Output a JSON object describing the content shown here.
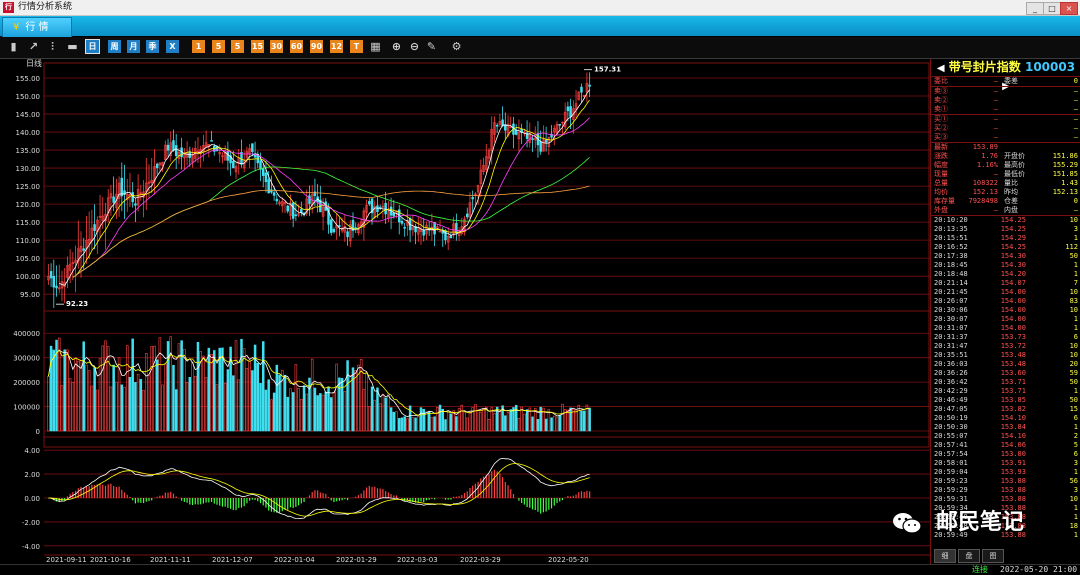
{
  "window": {
    "title": "行情分析系统",
    "app_icon": "行"
  },
  "tabs": [
    {
      "label": "行 情",
      "icon": "app-logo-icon"
    }
  ],
  "toolbar": {
    "icons": [
      {
        "name": "bar-chart-icon",
        "g": "▮",
        "style": "plain"
      },
      {
        "name": "line-chart-icon",
        "g": "↗",
        "style": "plain"
      },
      {
        "name": "kline-icon",
        "g": "⫶",
        "style": "plain"
      },
      {
        "name": "volume-icon",
        "g": "▬",
        "style": "plain"
      },
      {
        "name": "day-period-button",
        "g": "日",
        "style": "blue"
      },
      {
        "name": "week-period-button",
        "g": "周",
        "style": "blue"
      },
      {
        "name": "month-period-button",
        "g": "月",
        "style": "blue"
      },
      {
        "name": "quarter-period-button",
        "g": "季",
        "style": "blue"
      },
      {
        "name": "year-period-button",
        "g": "X",
        "style": "blue"
      },
      {
        "name": "minute1-button",
        "g": "1",
        "style": "orange"
      },
      {
        "name": "minute5-button",
        "g": "5",
        "style": "orange"
      },
      {
        "name": "minute10-button",
        "g": "5",
        "style": "orange"
      },
      {
        "name": "minute15-button",
        "g": "15",
        "style": "orange"
      },
      {
        "name": "minute30-button",
        "g": "30",
        "style": "orange"
      },
      {
        "name": "minute60-button",
        "g": "60",
        "style": "orange"
      },
      {
        "name": "minute90-button",
        "g": "90",
        "style": "orange"
      },
      {
        "name": "minute120-button",
        "g": "12",
        "style": "orange"
      },
      {
        "name": "tick-button",
        "g": "T",
        "style": "orange"
      },
      {
        "name": "calendar-icon",
        "g": "▦",
        "style": "plain"
      },
      {
        "name": "zoom-in-icon",
        "g": "⊕",
        "style": "plain"
      },
      {
        "name": "zoom-out-icon",
        "g": "⊖",
        "style": "plain"
      },
      {
        "name": "draw-tool-icon",
        "g": "✎",
        "style": "plain"
      },
      {
        "name": "settings-icon",
        "g": "⚙",
        "style": "plain"
      }
    ]
  },
  "chart": {
    "period_label": "日线",
    "max_label": "157.31",
    "min_label": "92.23",
    "price_ticks": [
      "155.00",
      "150.00",
      "145.00",
      "140.00",
      "135.00",
      "130.00",
      "125.00",
      "120.00",
      "115.00",
      "110.00",
      "105.00",
      "100.00",
      "95.00"
    ],
    "volume_ticks": [
      "400000",
      "300000",
      "200000",
      "100000",
      "0"
    ],
    "macd_ticks": [
      "4.00",
      "2.00",
      "0.00",
      "-2.00",
      "-4.00"
    ],
    "date_labels": [
      "2021-09-11",
      "2021-10-16",
      "2021-11-11",
      "2021-12-07",
      "2022-01-04",
      "2022-01-29",
      "2022-03-03",
      "2022-03-29",
      "2022-05-20"
    ],
    "colors": {
      "up": "#ff4040",
      "down": "#40e0f0",
      "grid": "#7a1010",
      "ma5": "#ffffff",
      "ma10": "#ffff00",
      "ma20": "#ff40ff",
      "ma60": "#40ff40",
      "ma120": "#ffa040"
    }
  },
  "chart_data": {
    "type": "candlestick",
    "price_range": [
      92.23,
      157.31
    ],
    "price_axis": [
      95,
      155
    ],
    "volume_axis": [
      0,
      400000
    ],
    "macd_axis": [
      -4,
      4
    ],
    "anchors": [
      {
        "i": 0,
        "p": 100
      },
      {
        "i": 4,
        "p": 97
      },
      {
        "i": 8,
        "p": 103
      },
      {
        "i": 14,
        "p": 110
      },
      {
        "i": 20,
        "p": 118
      },
      {
        "i": 26,
        "p": 124
      },
      {
        "i": 32,
        "p": 121
      },
      {
        "i": 38,
        "p": 128
      },
      {
        "i": 44,
        "p": 136
      },
      {
        "i": 50,
        "p": 133
      },
      {
        "i": 56,
        "p": 137
      },
      {
        "i": 62,
        "p": 135
      },
      {
        "i": 68,
        "p": 131
      },
      {
        "i": 74,
        "p": 134
      },
      {
        "i": 80,
        "p": 126
      },
      {
        "i": 86,
        "p": 120
      },
      {
        "i": 92,
        "p": 117
      },
      {
        "i": 98,
        "p": 122
      },
      {
        "i": 104,
        "p": 114
      },
      {
        "i": 110,
        "p": 112
      },
      {
        "i": 116,
        "p": 118
      },
      {
        "i": 122,
        "p": 120
      },
      {
        "i": 128,
        "p": 117
      },
      {
        "i": 134,
        "p": 114
      },
      {
        "i": 140,
        "p": 113
      },
      {
        "i": 146,
        "p": 111
      },
      {
        "i": 152,
        "p": 115
      },
      {
        "i": 158,
        "p": 125
      },
      {
        "i": 164,
        "p": 142
      },
      {
        "i": 170,
        "p": 140
      },
      {
        "i": 176,
        "p": 138
      },
      {
        "i": 182,
        "p": 136
      },
      {
        "i": 188,
        "p": 142
      },
      {
        "i": 194,
        "p": 148
      },
      {
        "i": 199,
        "p": 154
      }
    ],
    "bars": 200,
    "volume_levels": [
      {
        "from": 0,
        "to": 80,
        "v": 300000
      },
      {
        "from": 80,
        "to": 118,
        "v": 230000
      },
      {
        "from": 118,
        "to": 126,
        "v": 140000
      },
      {
        "from": 126,
        "to": 200,
        "v": 85000
      }
    ]
  },
  "quote": {
    "name": "带号封片指数",
    "code": "100003",
    "order_rows": [
      {
        "l": "委比",
        "v": "—",
        "l2": "委差",
        "v2": "0"
      },
      {
        "l": "卖③",
        "v": "—",
        "l2": "",
        "v2": "—"
      },
      {
        "l": "卖②",
        "v": "—",
        "l2": "",
        "v2": "—"
      },
      {
        "l": "卖①",
        "v": "—",
        "l2": "",
        "v2": "—"
      },
      {
        "l": "买①",
        "v": "—",
        "l2": "",
        "v2": "—"
      },
      {
        "l": "买②",
        "v": "—",
        "l2": "",
        "v2": "—"
      },
      {
        "l": "买③",
        "v": "—",
        "l2": "",
        "v2": "—"
      }
    ],
    "stat_rows": [
      {
        "l": "最新",
        "v": "153.89",
        "l2": "",
        "v2": ""
      },
      {
        "l": "涨跌",
        "v": "1.76",
        "l2": "开盘价",
        "v2": "151.86"
      },
      {
        "l": "幅度",
        "v": "1.16%",
        "l2": "最高价",
        "v2": "155.29"
      },
      {
        "l": "现量",
        "v": "—",
        "l2": "最低价",
        "v2": "151.85"
      },
      {
        "l": "总量",
        "v": "108322",
        "l2": "量比",
        "v2": "1.43"
      },
      {
        "l": "均价",
        "v": "152.13",
        "l2": "昨均",
        "v2": "152.13"
      },
      {
        "l": "库存量",
        "v": "7928498",
        "l2": "仓差",
        "v2": "0"
      },
      {
        "l": "外盘",
        "v": "—",
        "l2": "内盘",
        "v2": "—"
      }
    ],
    "trades": [
      [
        "20:10:20",
        "154.25",
        "10"
      ],
      [
        "20:13:35",
        "154.25",
        "3"
      ],
      [
        "20:15:51",
        "154.29",
        "1"
      ],
      [
        "20:16:52",
        "154.25",
        "112"
      ],
      [
        "20:17:38",
        "154.30",
        "50"
      ],
      [
        "20:18:45",
        "154.30",
        "1"
      ],
      [
        "20:18:48",
        "154.20",
        "1"
      ],
      [
        "20:21:14",
        "154.07",
        "7"
      ],
      [
        "20:21:45",
        "154.00",
        "10"
      ],
      [
        "20:26:07",
        "154.00",
        "83"
      ],
      [
        "20:30:06",
        "154.00",
        "10"
      ],
      [
        "20:30:07",
        "154.00",
        "1"
      ],
      [
        "20:31:07",
        "154.00",
        "1"
      ],
      [
        "20:31:37",
        "153.73",
        "6"
      ],
      [
        "20:31:47",
        "153.72",
        "10"
      ],
      [
        "20:35:51",
        "153.48",
        "10"
      ],
      [
        "20:36:03",
        "153.48",
        "20"
      ],
      [
        "20:36:26",
        "153.60",
        "59"
      ],
      [
        "20:36:42",
        "153.71",
        "50"
      ],
      [
        "20:42:29",
        "153.71",
        "1"
      ],
      [
        "20:46:49",
        "153.85",
        "50"
      ],
      [
        "20:47:05",
        "153.82",
        "15"
      ],
      [
        "20:50:19",
        "154.10",
        "6"
      ],
      [
        "20:50:30",
        "153.84",
        "1"
      ],
      [
        "20:55:07",
        "154.10",
        "2"
      ],
      [
        "20:57:41",
        "154.06",
        "5"
      ],
      [
        "20:57:54",
        "153.80",
        "6"
      ],
      [
        "20:58:01",
        "153.91",
        "3"
      ],
      [
        "20:59:04",
        "153.93",
        "1"
      ],
      [
        "20:59:23",
        "153.88",
        "56"
      ],
      [
        "20:59:29",
        "153.88",
        "3"
      ],
      [
        "20:59:31",
        "153.88",
        "10"
      ],
      [
        "20:59:34",
        "153.88",
        "1"
      ],
      [
        "20:59:40",
        "153.88",
        "1"
      ],
      [
        "20:59:48",
        "153.88",
        "18"
      ],
      [
        "20:59:49",
        "153.88",
        "1"
      ]
    ],
    "tabs": [
      "细",
      "盘",
      "图"
    ]
  },
  "status": {
    "connection": "连接",
    "datetime": "2022-05-20 21:00"
  },
  "watermark": {
    "text": "邮民笔记",
    "icon": "wechat-icon"
  }
}
